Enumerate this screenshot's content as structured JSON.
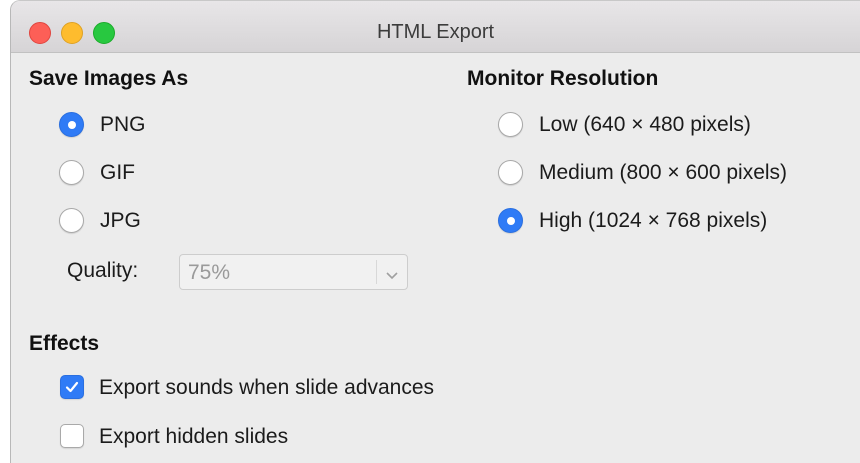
{
  "window": {
    "title": "HTML Export"
  },
  "save_images": {
    "heading": "Save Images As",
    "options": [
      {
        "label": "PNG",
        "selected": true
      },
      {
        "label": "GIF",
        "selected": false
      },
      {
        "label": "JPG",
        "selected": false
      }
    ],
    "quality": {
      "label": "Quality:",
      "value": "75%",
      "enabled": false
    }
  },
  "monitor_resolution": {
    "heading": "Monitor Resolution",
    "options": [
      {
        "label": "Low (640 × 480 pixels)",
        "selected": false
      },
      {
        "label": "Medium (800 × 600 pixels)",
        "selected": false
      },
      {
        "label": "High (1024 × 768 pixels)",
        "selected": true
      }
    ]
  },
  "effects": {
    "heading": "Effects",
    "options": [
      {
        "label": "Export sounds when slide advances",
        "checked": true
      },
      {
        "label": "Export hidden slides",
        "checked": false
      }
    ]
  },
  "colors": {
    "accent": "#2f7bf6",
    "close": "#fd5f57",
    "minimize": "#febc2e",
    "zoom": "#28c840"
  }
}
